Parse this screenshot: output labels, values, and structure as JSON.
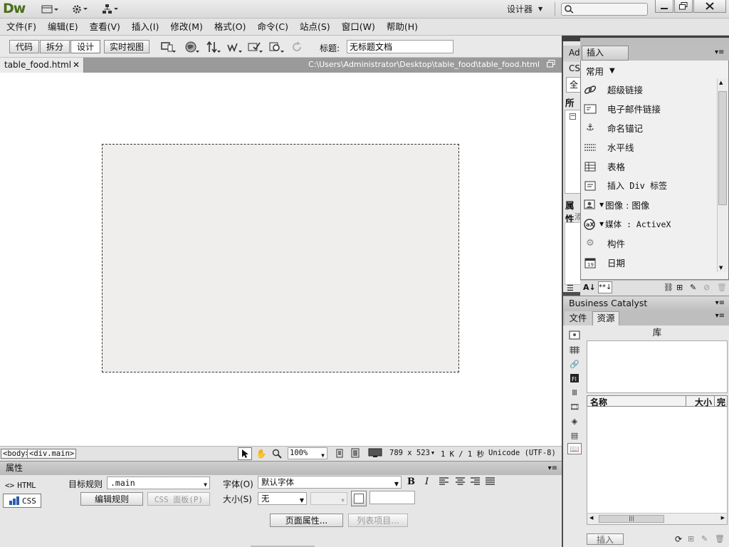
{
  "app": {
    "logo": "Dw",
    "workspace_label": "设计器",
    "search_placeholder": ""
  },
  "menu": [
    "文件(F)",
    "编辑(E)",
    "查看(V)",
    "插入(I)",
    "修改(M)",
    "格式(O)",
    "命令(C)",
    "站点(S)",
    "窗口(W)",
    "帮助(H)"
  ],
  "doc_toolbar": {
    "views": [
      "代码",
      "拆分",
      "设计",
      "实时视图"
    ],
    "active_view": "设计",
    "title_label": "标题:",
    "title_value": "无标题文档"
  },
  "doc_tab": {
    "filename": "table_food.html",
    "path": "C:\\Users\\Administrator\\Desktop\\table_food\\table_food.html"
  },
  "status_bar": {
    "tags": [
      "<body>",
      "<div.main>"
    ],
    "zoom": "100%",
    "dimensions": "789 x 523",
    "size": "1 K / 1 秒",
    "encoding": "Unicode (UTF-8)"
  },
  "properties": {
    "header": "属性",
    "html_label": "HTML",
    "css_label": "CSS",
    "target_rule_label": "目标规则",
    "target_rule_value": ".main",
    "edit_rule": "编辑规则",
    "css_panel": "CSS 面板(P)",
    "font_label": "字体(O)",
    "font_value": "默认字体",
    "size_label": "大小(S)",
    "size_value": "无",
    "page_props": "页面属性...",
    "list_item": "列表项目..."
  },
  "css_panel": {
    "tab_partial": "CS",
    "ad_partial": "Ad",
    "all_partial": "全",
    "all_rules_partial": "所有",
    "props_partial": "属性",
    "chinese_partial": "添"
  },
  "insert_panel": {
    "tab": "插入",
    "category": "常用",
    "items": [
      {
        "icon": "hyperlink-icon",
        "label": "超级链接"
      },
      {
        "icon": "email-link-icon",
        "label": "电子邮件链接"
      },
      {
        "icon": "anchor-icon",
        "label": "命名锚记"
      },
      {
        "icon": "horizontal-rule-icon",
        "label": "水平线"
      },
      {
        "icon": "table-icon",
        "label": "表格"
      },
      {
        "icon": "div-icon",
        "label": "插入 Div 标签"
      },
      {
        "icon": "image-icon",
        "label": "图像 : 图像"
      },
      {
        "icon": "media-icon",
        "label": "媒体 : ActiveX"
      },
      {
        "icon": "widget-icon",
        "label": "构件"
      },
      {
        "icon": "date-icon",
        "label": "日期"
      }
    ]
  },
  "business_catalyst": {
    "title": "Business Catalyst"
  },
  "files_panel": {
    "tabs": [
      "文件",
      "资源"
    ],
    "active_tab": "资源",
    "library_title": "库",
    "columns": [
      "名称",
      "大小",
      "完"
    ],
    "insert_button": "插入"
  }
}
